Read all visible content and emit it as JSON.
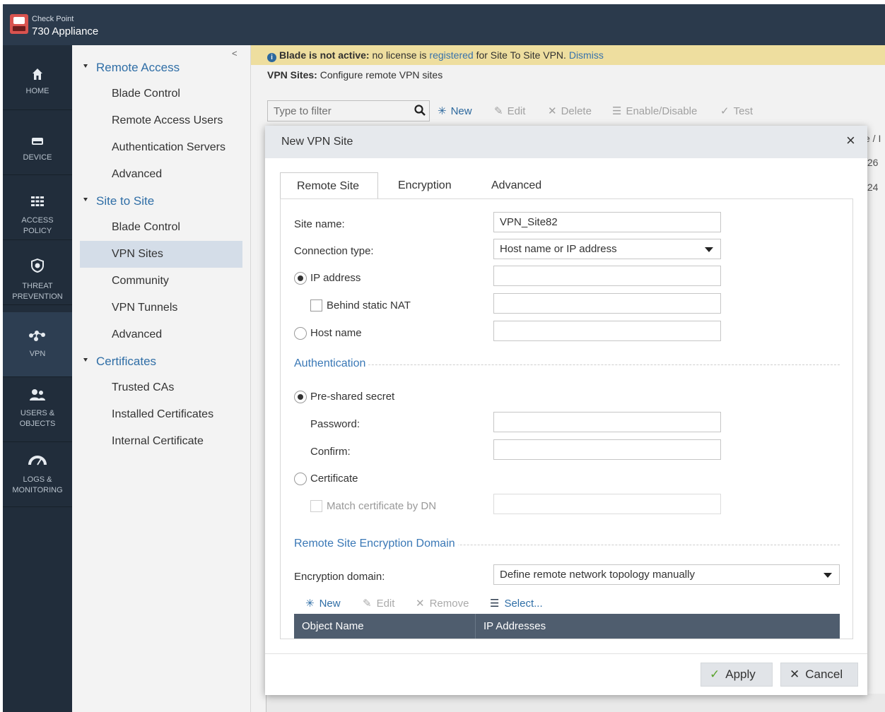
{
  "header": {
    "brand_top": "Check Point",
    "brand_main": "730 Appliance"
  },
  "icon_nav": [
    {
      "label": "HOME",
      "icon": "home-icon"
    },
    {
      "label": "DEVICE",
      "icon": "device-icon"
    },
    {
      "label": "ACCESS POLICY",
      "icon": "access-policy-icon"
    },
    {
      "label": "THREAT PREVENTION",
      "icon": "shield-icon"
    },
    {
      "label": "VPN",
      "icon": "vpn-network-icon"
    },
    {
      "label": "USERS & OBJECTS",
      "icon": "users-icon"
    },
    {
      "label": "LOGS & MONITORING",
      "icon": "gauge-icon"
    }
  ],
  "sec_nav": {
    "sections": [
      {
        "title": "Remote Access",
        "items": [
          "Blade Control",
          "Remote Access Users",
          "Authentication Servers",
          "Advanced"
        ]
      },
      {
        "title": "Site to Site",
        "items": [
          "Blade Control",
          "VPN Sites",
          "Community",
          "VPN Tunnels",
          "Advanced"
        ]
      },
      {
        "title": "Certificates",
        "items": [
          "Trusted CAs",
          "Installed Certificates",
          "Internal Certificate"
        ]
      }
    ],
    "active_item": "VPN Sites"
  },
  "banner": {
    "bold": "Blade is not active:",
    "text1": " no license is ",
    "link1": "registered",
    "text2": " for Site To Site VPN. ",
    "link2": "Dismiss"
  },
  "page": {
    "subtitle_bold": "VPN Sites:",
    "subtitle": " Configure remote VPN sites"
  },
  "toolbar": {
    "filter_placeholder": "Type to filter",
    "new": "New",
    "edit": "Edit",
    "delete": "Delete",
    "enable_disable": "Enable/Disable",
    "test": "Test"
  },
  "bg_table": {
    "header_fragment": "e / I",
    "row1": ".26",
    "row2": ".24"
  },
  "modal": {
    "title": "New VPN Site",
    "tabs": [
      "Remote Site",
      "Encryption",
      "Advanced"
    ],
    "active_tab": "Remote Site",
    "site_name_label": "Site name:",
    "site_name_value": "VPN_Site82",
    "connection_type_label": "Connection type:",
    "connection_type_value": "Host name or IP address",
    "ip_address_label": "IP address",
    "behind_nat_label": "Behind static NAT",
    "host_name_label": "Host name",
    "auth_section": "Authentication",
    "pre_shared_label": "Pre-shared secret",
    "password_label": "Password:",
    "confirm_label": "Confirm:",
    "certificate_label": "Certificate",
    "match_dn_label": "Match certificate by DN",
    "domain_section": "Remote Site Encryption Domain",
    "encryption_domain_label": "Encryption domain:",
    "encryption_domain_value": "Define remote network topology manually",
    "domain_toolbar": {
      "new": "New",
      "edit": "Edit",
      "remove": "Remove",
      "select": "Select..."
    },
    "table_headers": [
      "Object Name",
      "IP Addresses"
    ],
    "apply": "Apply",
    "cancel": "Cancel"
  },
  "colors": {
    "accent": "#2f6ea6",
    "topbar": "#2b3a4c",
    "nav_bg": "#212d3b",
    "banner_bg": "#fbeaa8",
    "table_header": "#4f5d6e"
  }
}
